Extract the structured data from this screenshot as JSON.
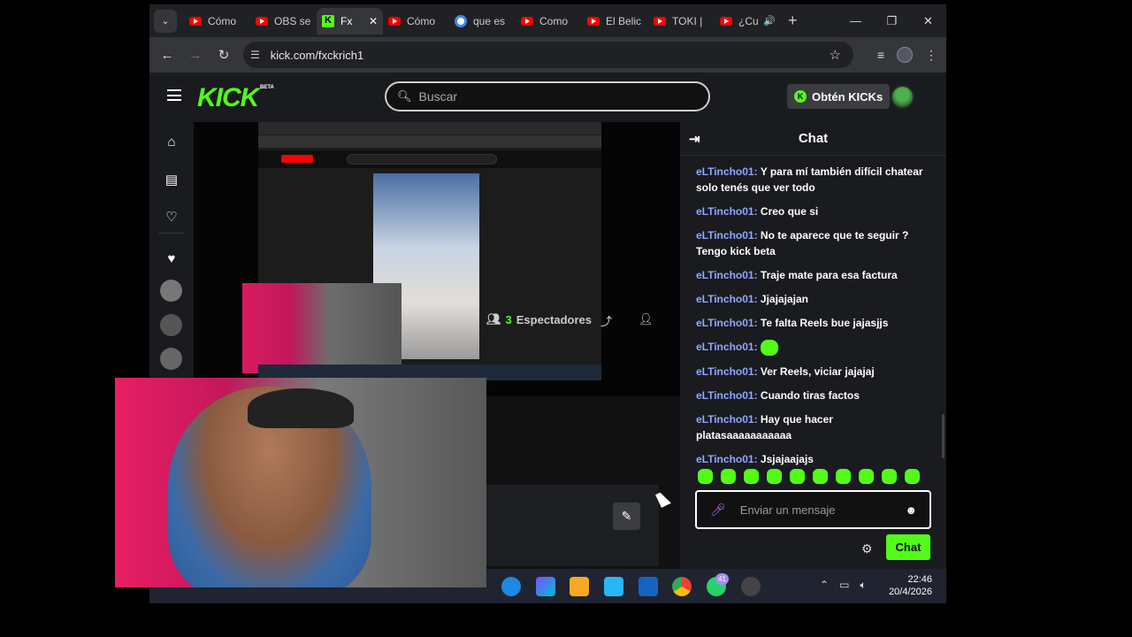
{
  "browser": {
    "tabs": [
      {
        "label": "Cómo",
        "icon": "youtube-icon"
      },
      {
        "label": "OBS se",
        "icon": "youtube-icon"
      },
      {
        "label": "Fx",
        "icon": "kick-icon",
        "active": true
      },
      {
        "label": "Cómo",
        "icon": "youtube-icon"
      },
      {
        "label": "que es",
        "icon": "google-icon"
      },
      {
        "label": "Como",
        "icon": "youtube-icon"
      },
      {
        "label": "El Belic",
        "icon": "youtube-icon"
      },
      {
        "label": "TOKI |",
        "icon": "youtube-icon"
      },
      {
        "label": "¿Cu",
        "icon": "youtube-icon",
        "audio": true
      }
    ],
    "url": "kick.com/fxckrich1"
  },
  "kick": {
    "logo": "KICK",
    "beta": "BETA",
    "search_placeholder": "Buscar",
    "get_kicks": "Obtén KICKs",
    "brand_color": "#53fc18"
  },
  "stream": {
    "viewer_count": "3",
    "viewer_label": "Espectadores"
  },
  "chat": {
    "title": "Chat",
    "messages": [
      {
        "user": "eLTincho01:",
        "text": " Y para mí también difícil chatear solo tenés que ver todo"
      },
      {
        "user": "eLTincho01:",
        "text": " Creo que si"
      },
      {
        "user": "eLTincho01:",
        "text": " No te aparece que te seguir ? Tengo kick beta"
      },
      {
        "user": "eLTincho01:",
        "text": " Traje mate para esa factura"
      },
      {
        "user": "eLTincho01:",
        "text": " Jjajajajan"
      },
      {
        "user": "eLTincho01:",
        "text": " Te falta Reels bue jajasjjs"
      },
      {
        "user": "eLTincho01:",
        "text": " ",
        "emote": true
      },
      {
        "user": "eLTincho01:",
        "text": " Ver Reels, viciar jajajaj"
      },
      {
        "user": "eLTincho01:",
        "text": " Cuando tiras factos"
      },
      {
        "user": "eLTincho01:",
        "text": " Hay que hacer platasaaaaaaaaaaa"
      },
      {
        "user": "eLTincho01:",
        "text": " Jsjajaajajs"
      }
    ],
    "input_placeholder": "Enviar un mensaje",
    "send_label": "Chat"
  },
  "taskbar": {
    "whatsapp_badge": "41",
    "time": "22:46",
    "date": "20/4/2026"
  }
}
